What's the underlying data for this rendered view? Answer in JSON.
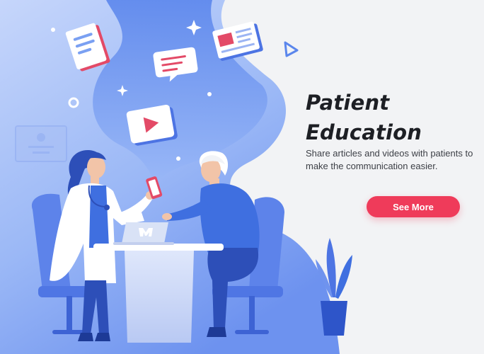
{
  "hero": {
    "title_line1": "Patient",
    "title_line2": "Education",
    "description": "Share articles and videos with patients to make the communication easier.",
    "cta_label": "See More"
  },
  "colors": {
    "background": "#f2f3f5",
    "primary_blue": "#3f6fe0",
    "light_blue": "#8fb0f7",
    "accent_red": "#ef3b5a"
  },
  "icons": [
    "document-icon",
    "chat-bubble-icon",
    "book-icon",
    "video-play-icon",
    "phone-icon",
    "laptop-icon",
    "sparkle-icon",
    "triangle-icon",
    "plant-icon",
    "certificate-icon"
  ]
}
